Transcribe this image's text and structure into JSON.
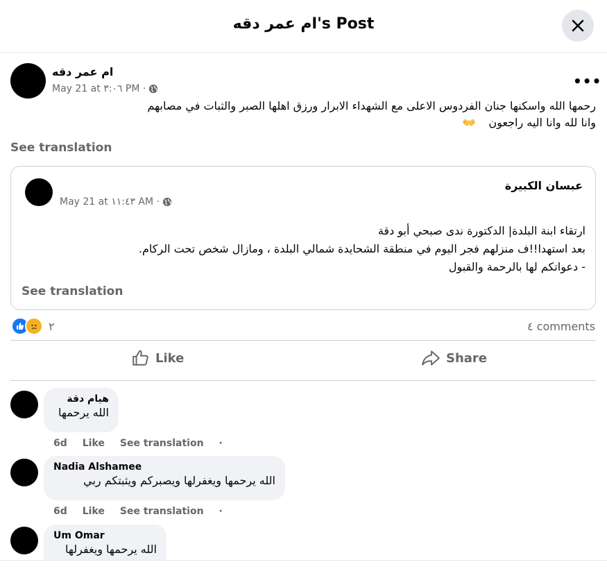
{
  "header": {
    "title": "ام عمر دقه's Post"
  },
  "post": {
    "author": "ام عمر دقه",
    "meta": "May 21 at ٣:٠٦ PM ·",
    "line1": "رحمها الله واسكنها جنان الفردوس الاعلى مع الشهداء الابرار ورزق اهلها الصبر والثبات في مصابهم",
    "line2": "وانا لله وانا اليه راجعون",
    "emoji": "👐",
    "see_translation": "See translation",
    "shared": {
      "author": "عبسان الكبيرة",
      "meta": "May 21 at ١١:٤٣ AM ·",
      "line1": "ارتقاء ابنة البلدة| الدكتورة ندى صبحي أبو دقة",
      "line2": "بعد استهدا!!ف منزلهم فجر اليوم في منطقة الشحايدة شمالي البلدة ، ومازال شخص تحت الركام.",
      "line3": "- دعواتكم لها بالرحمة والقبول",
      "see_translation": "See translation"
    },
    "reaction_count": "٢",
    "comments_count": "٤ comments"
  },
  "actions": {
    "like": "Like",
    "share": "Share"
  },
  "comments": [
    {
      "author": "هيام دقة",
      "text": "الله يرحمها",
      "time": "6d",
      "like": "Like",
      "translate": "See translation",
      "dot": "·"
    },
    {
      "author": "Nadia Alshamee",
      "text": "الله يرحمها ويغفرلها ويصبركم ويثبتكم ربي",
      "time": "6d",
      "like": "Like",
      "translate": "See translation",
      "dot": "·"
    },
    {
      "author": "Um Omar",
      "text": "الله يرحمها ويغفرلها"
    }
  ]
}
